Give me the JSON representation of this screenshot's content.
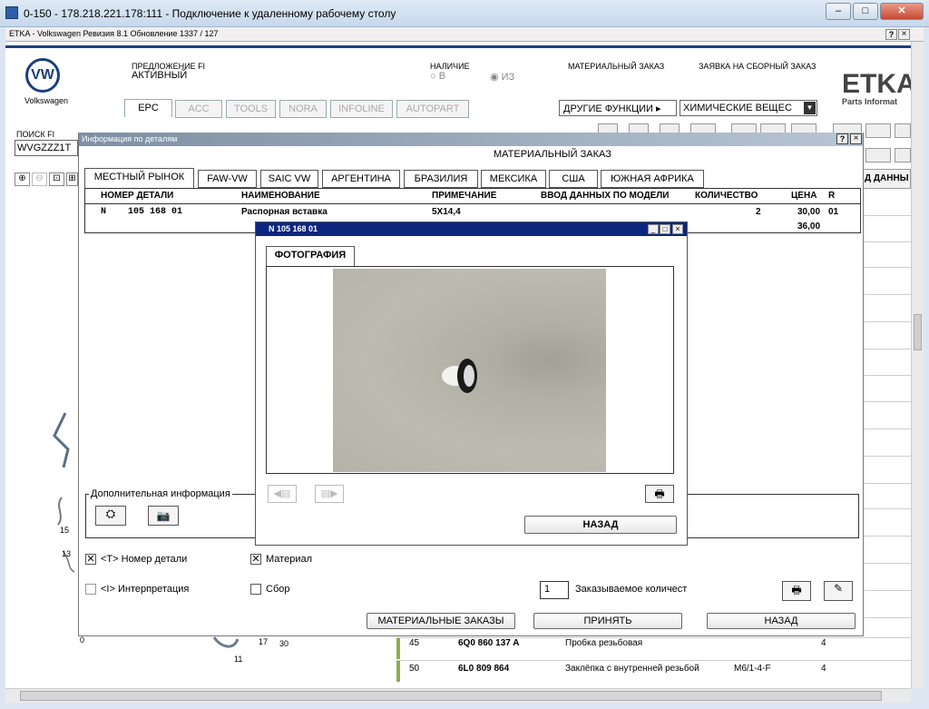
{
  "rdp": {
    "title": "0-150 - 178.218.221.178:111 - Подключение к удаленному рабочему столу"
  },
  "etka": {
    "title": "ETKA - Volkswagen Ревизия 8.1 Обновление 1337 / 127",
    "help": "?",
    "close": "×"
  },
  "brand": {
    "name": "Volkswagen",
    "vw": "VW",
    "etka_logo": "ETKA",
    "etka_sub": "Parts Informat"
  },
  "header": {
    "offer_label": "ПРЕДЛОЖЕНИЕ FI",
    "offer_value": "АКТИВНЫЙ",
    "avail_label": "НАЛИЧИЕ",
    "avail_in": "В",
    "avail_out": "ИЗ",
    "mat_order": "МАТЕРИАЛЬНЫЙ ЗАКАЗ",
    "assembly_order": "ЗАЯВКА НА СБОРНЫЙ ЗАКАЗ",
    "other_funcs": "ДРУГИЕ ФУНКЦИИ",
    "chem_select": "ХИМИЧЕСКИЕ ВЕЩЕС"
  },
  "tabs": [
    "EPC",
    "ACC",
    "TOOLS",
    "NORA",
    "INFOLINE",
    "AUTOPART"
  ],
  "search": {
    "label": "ПОИСК FI",
    "value": "WVGZZZ1T"
  },
  "bg": {
    "data_col": "Д ДАННЫ",
    "n15": "15",
    "n13": "13",
    "n11": "11",
    "n17": "17",
    "n30": "30",
    "n0": "0"
  },
  "dialog": {
    "title": "Информация по деталям",
    "heading": "МАТЕРИАЛЬНЫЙ ЗАКАЗ",
    "help": "?",
    "close": "×",
    "markets": [
      "МЕСТНЫЙ РЫНОК",
      "FAW-VW",
      "SAIC VW",
      "АРГЕНТИНА",
      "БРАЗИЛИЯ",
      "МЕКСИКА",
      "США",
      "ЮЖНАЯ АФРИКА"
    ],
    "cols": [
      "НОМЕР ДЕТАЛИ",
      "НАИМЕНОВАНИЕ",
      "ПРИМЕЧАНИЕ",
      "ВВОД ДАННЫХ ПО МОДЕЛИ",
      "КОЛИЧЕСТВО",
      "ЦЕНА",
      "R"
    ],
    "row": {
      "prefix": "N",
      "part": "105 168 01",
      "name": "Распорная вставка",
      "note": "5X14,4",
      "qty": "2",
      "price": "30,00",
      "r": "01",
      "price2": "36,00"
    },
    "extra": "Дополнительная информация",
    "cb_part": "<T> Номер детали",
    "cb_material": "Материал",
    "cb_interp": "<I> Интерпретация",
    "cb_assembly": "Сбор",
    "qty_value": "1",
    "qty_label": "Заказываемое количест",
    "btn_orders": "МАТЕРИАЛЬНЫЕ ЗАКАЗЫ",
    "btn_accept": "ПРИНЯТЬ",
    "btn_back": "НАЗАД"
  },
  "photo": {
    "title": "N  105 168 01",
    "tab": "ФОТОГРАФИЯ",
    "back": "НАЗАД"
  },
  "list": [
    {
      "num": "45",
      "part": "6Q0 860 137 A",
      "name": "Пробка резьбовая",
      "note": "",
      "qty": "4"
    },
    {
      "num": "50",
      "part": "6L0 809 864",
      "name": "Заклёпка с внутренней резьбой",
      "note": "M6/1-4-F",
      "qty": "4"
    }
  ]
}
